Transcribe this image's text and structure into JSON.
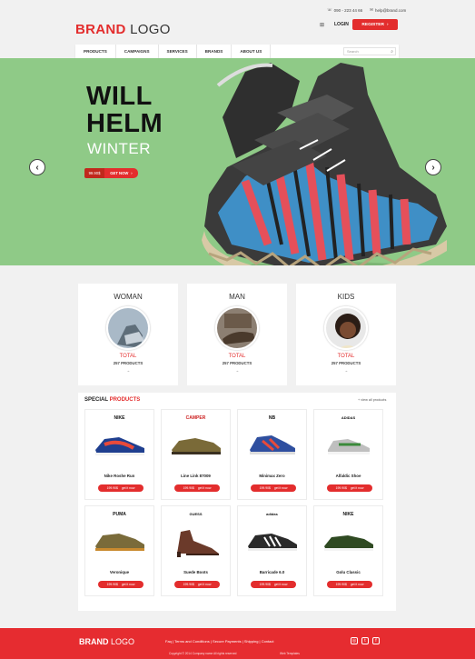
{
  "header": {
    "brand_strong": "BRAND",
    "brand_light": "LOGO",
    "phone": "090 - 223 44 66",
    "email": "help@brand.com",
    "login_label": "LOGIN",
    "register_label": "REGISTER"
  },
  "nav": {
    "items": [
      "PRODUCTS",
      "CAMPAIGNS",
      "SERVICES",
      "BRANDS",
      "ABOUT US"
    ],
    "search_placeholder": "Search"
  },
  "hero": {
    "title_line1": "WILL",
    "title_line2": "HELM",
    "subtitle": "WINTER",
    "price": "99.90$",
    "cta_label": "GET NOW",
    "bg_color": "#8fca87"
  },
  "categories": [
    {
      "title": "WOMAN",
      "total_label": "TOTAL",
      "count": "257 PRODUCTS"
    },
    {
      "title": "MAN",
      "total_label": "TOTAL",
      "count": "257 PRODUCTS"
    },
    {
      "title": "KIDS",
      "total_label": "TOTAL",
      "count": "257 PRODUCTS"
    }
  ],
  "special": {
    "title_a": "SPECIAL",
    "title_b": "PRODUCTS",
    "view_all": "+ view all products",
    "products": [
      {
        "brand": "NIKE",
        "name": "Nike Roshe Run",
        "price": "199.90$",
        "cta": "get it now"
      },
      {
        "brand": "CAMPER",
        "name": "Line Link 87009",
        "price": "199.90$",
        "cta": "get it now"
      },
      {
        "brand": "NB",
        "name": "Minimax Zero",
        "price": "199.90$",
        "cta": "get it now"
      },
      {
        "brand": "ADIDAS",
        "name": "Alfaldic Shoe",
        "price": "199.90$",
        "cta": "get it now"
      },
      {
        "brand": "PUMA",
        "name": "Veronique",
        "price": "199.90$",
        "cta": "get it now"
      },
      {
        "brand": "GUESS",
        "name": "Suede Boots",
        "price": "199.90$",
        "cta": "get it now"
      },
      {
        "brand": "adidas",
        "name": "Barricade 6.0",
        "price": "199.90$",
        "cta": "get it now"
      },
      {
        "brand": "NIKE",
        "name": "Golu Classic",
        "price": "199.90$",
        "cta": "get it now"
      }
    ]
  },
  "footer": {
    "brand_strong": "BRAND",
    "brand_light": "LOGO",
    "links": "Faq | Terms and Conditions | Secure Payments | Shipping | Contact",
    "copyright": "Copyright © 2014 Company name All rights reserved",
    "credit": "Web Templates",
    "accent": "#e62c30"
  }
}
